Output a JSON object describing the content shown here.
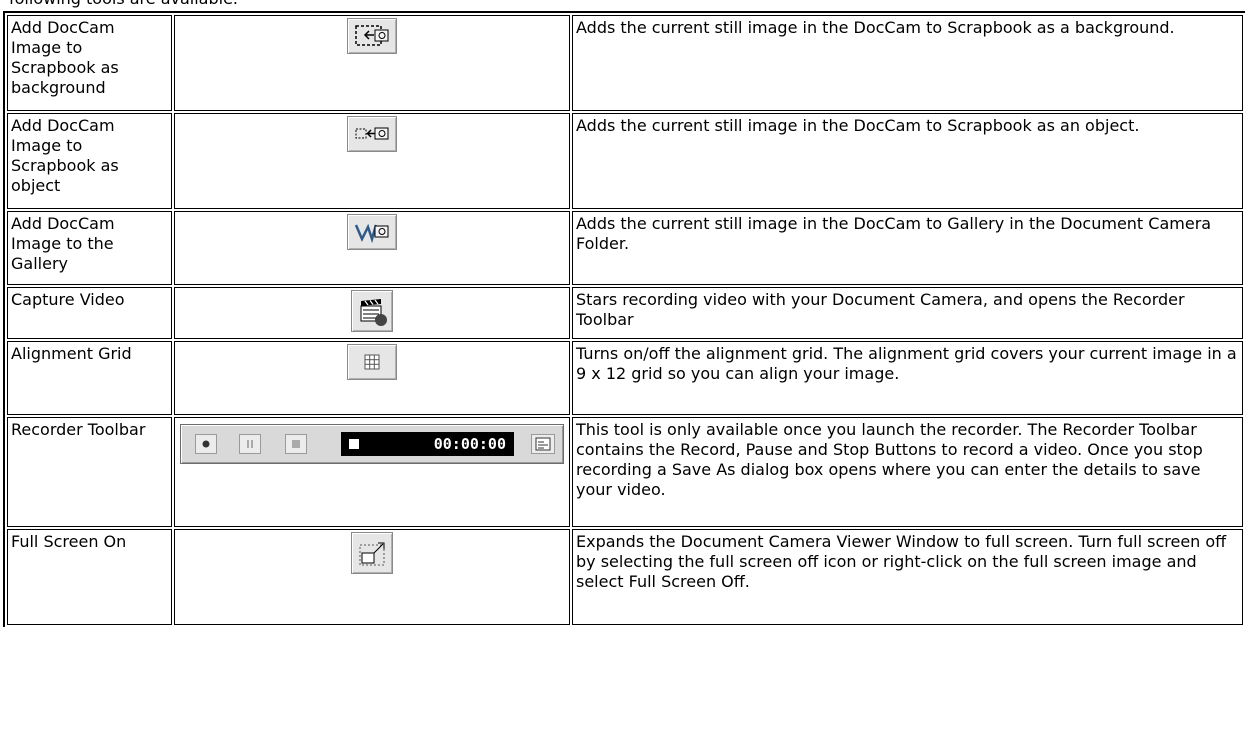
{
  "intro_text": "following tools are available.",
  "rows": [
    {
      "name": "Add DocCam Image to Scrapbook as background",
      "icon": "add-background-icon",
      "description": "Adds the current still image in the DocCam to Scrapbook as a background."
    },
    {
      "name": "Add DocCam Image to Scrapbook as object",
      "icon": "add-object-icon",
      "description": "Adds the current still image in the DocCam to Scrapbook as an object."
    },
    {
      "name": "Add DocCam Image to the Gallery",
      "icon": "add-gallery-icon",
      "description": "Adds the current still image in the DocCam to Gallery in the Document Camera Folder."
    },
    {
      "name": "Capture Video",
      "icon": "clapperboard-record-icon",
      "description": "Stars recording video with your Document Camera, and opens the Recorder Toolbar"
    },
    {
      "name": "Alignment Grid",
      "icon": "grid-icon",
      "description": "Turns on/off the alignment grid. The alignment grid covers your current image in a 9 x 12 grid so you can align your image."
    },
    {
      "name": "Recorder Toolbar",
      "icon": "recorder-toolbar-icon",
      "timer": "00:00:00",
      "description": "This tool is only available once you launch the recorder. The Recorder Toolbar contains the Record, Pause and Stop Buttons to record a video. Once you stop recording a Save As dialog box opens where you can enter the details to save your video."
    },
    {
      "name": "Full Screen On",
      "icon": "full-screen-icon",
      "description": "Expands the Document Camera Viewer Window to full screen. Turn full screen off by selecting the full screen off icon or right-click on the full screen image and select Full Screen Off."
    }
  ]
}
